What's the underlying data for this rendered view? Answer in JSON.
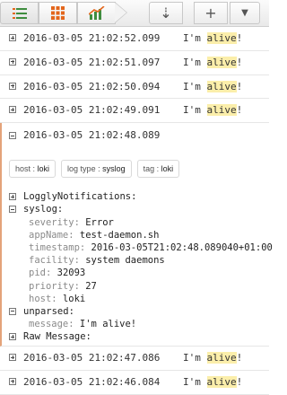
{
  "toolbar": {
    "views": [
      {
        "name": "list-view-icon",
        "active": true
      },
      {
        "name": "grid-view-icon",
        "active": false
      },
      {
        "name": "chart-view-icon",
        "active": false
      }
    ],
    "actions": [
      {
        "name": "sort-icon",
        "glyph": "⇣"
      },
      {
        "name": "add-icon",
        "glyph": "+"
      },
      {
        "name": "dropdown-icon",
        "glyph": "▾"
      }
    ]
  },
  "highlight_color": "#fbeeaa",
  "accent_color": "#e4a37a",
  "rows_before": [
    {
      "timestamp": "2016-03-05 21:02:52.099",
      "msg_prefix": "I'm ",
      "msg_highlight": "alive",
      "msg_suffix": "!"
    },
    {
      "timestamp": "2016-03-05 21:02:51.097",
      "msg_prefix": "I'm ",
      "msg_highlight": "alive",
      "msg_suffix": "!"
    },
    {
      "timestamp": "2016-03-05 21:02:50.094",
      "msg_prefix": "I'm ",
      "msg_highlight": "alive",
      "msg_suffix": "!"
    },
    {
      "timestamp": "2016-03-05 21:02:49.091",
      "msg_prefix": "I'm ",
      "msg_highlight": "alive",
      "msg_suffix": "!"
    }
  ],
  "expanded": {
    "timestamp": "2016-03-05 21:02:48.089",
    "tags": [
      {
        "key": "host",
        "value": "loki"
      },
      {
        "key": "log type",
        "value": "syslog"
      },
      {
        "key": "tag",
        "value": "loki"
      }
    ],
    "tree": [
      {
        "toggle": "plus",
        "key": "LogglyNotifications:",
        "value": ""
      },
      {
        "toggle": "minus",
        "key": "syslog:",
        "value": ""
      },
      {
        "level": 1,
        "key": "severity:",
        "value": "Error"
      },
      {
        "level": 1,
        "key": "appName:",
        "value": "test-daemon.sh"
      },
      {
        "level": 1,
        "key": "timestamp:",
        "value": "2016-03-05T21:02:48.089040+01:00"
      },
      {
        "level": 1,
        "key": "facility:",
        "value": "system daemons"
      },
      {
        "level": 1,
        "key": "pid:",
        "value": "32093"
      },
      {
        "level": 1,
        "key": "priority:",
        "value": "27"
      },
      {
        "level": 1,
        "key": "host:",
        "value": "loki"
      },
      {
        "toggle": "minus",
        "key": "unparsed:",
        "value": ""
      },
      {
        "level": 1,
        "key": "message:",
        "value": "I'm alive!"
      },
      {
        "toggle": "plus",
        "key": "Raw Message:",
        "value": ""
      }
    ]
  },
  "rows_after": [
    {
      "timestamp": "2016-03-05 21:02:47.086",
      "msg_prefix": "I'm ",
      "msg_highlight": "alive",
      "msg_suffix": "!"
    },
    {
      "timestamp": "2016-03-05 21:02:46.084",
      "msg_prefix": "I'm ",
      "msg_highlight": "alive",
      "msg_suffix": "!"
    }
  ]
}
